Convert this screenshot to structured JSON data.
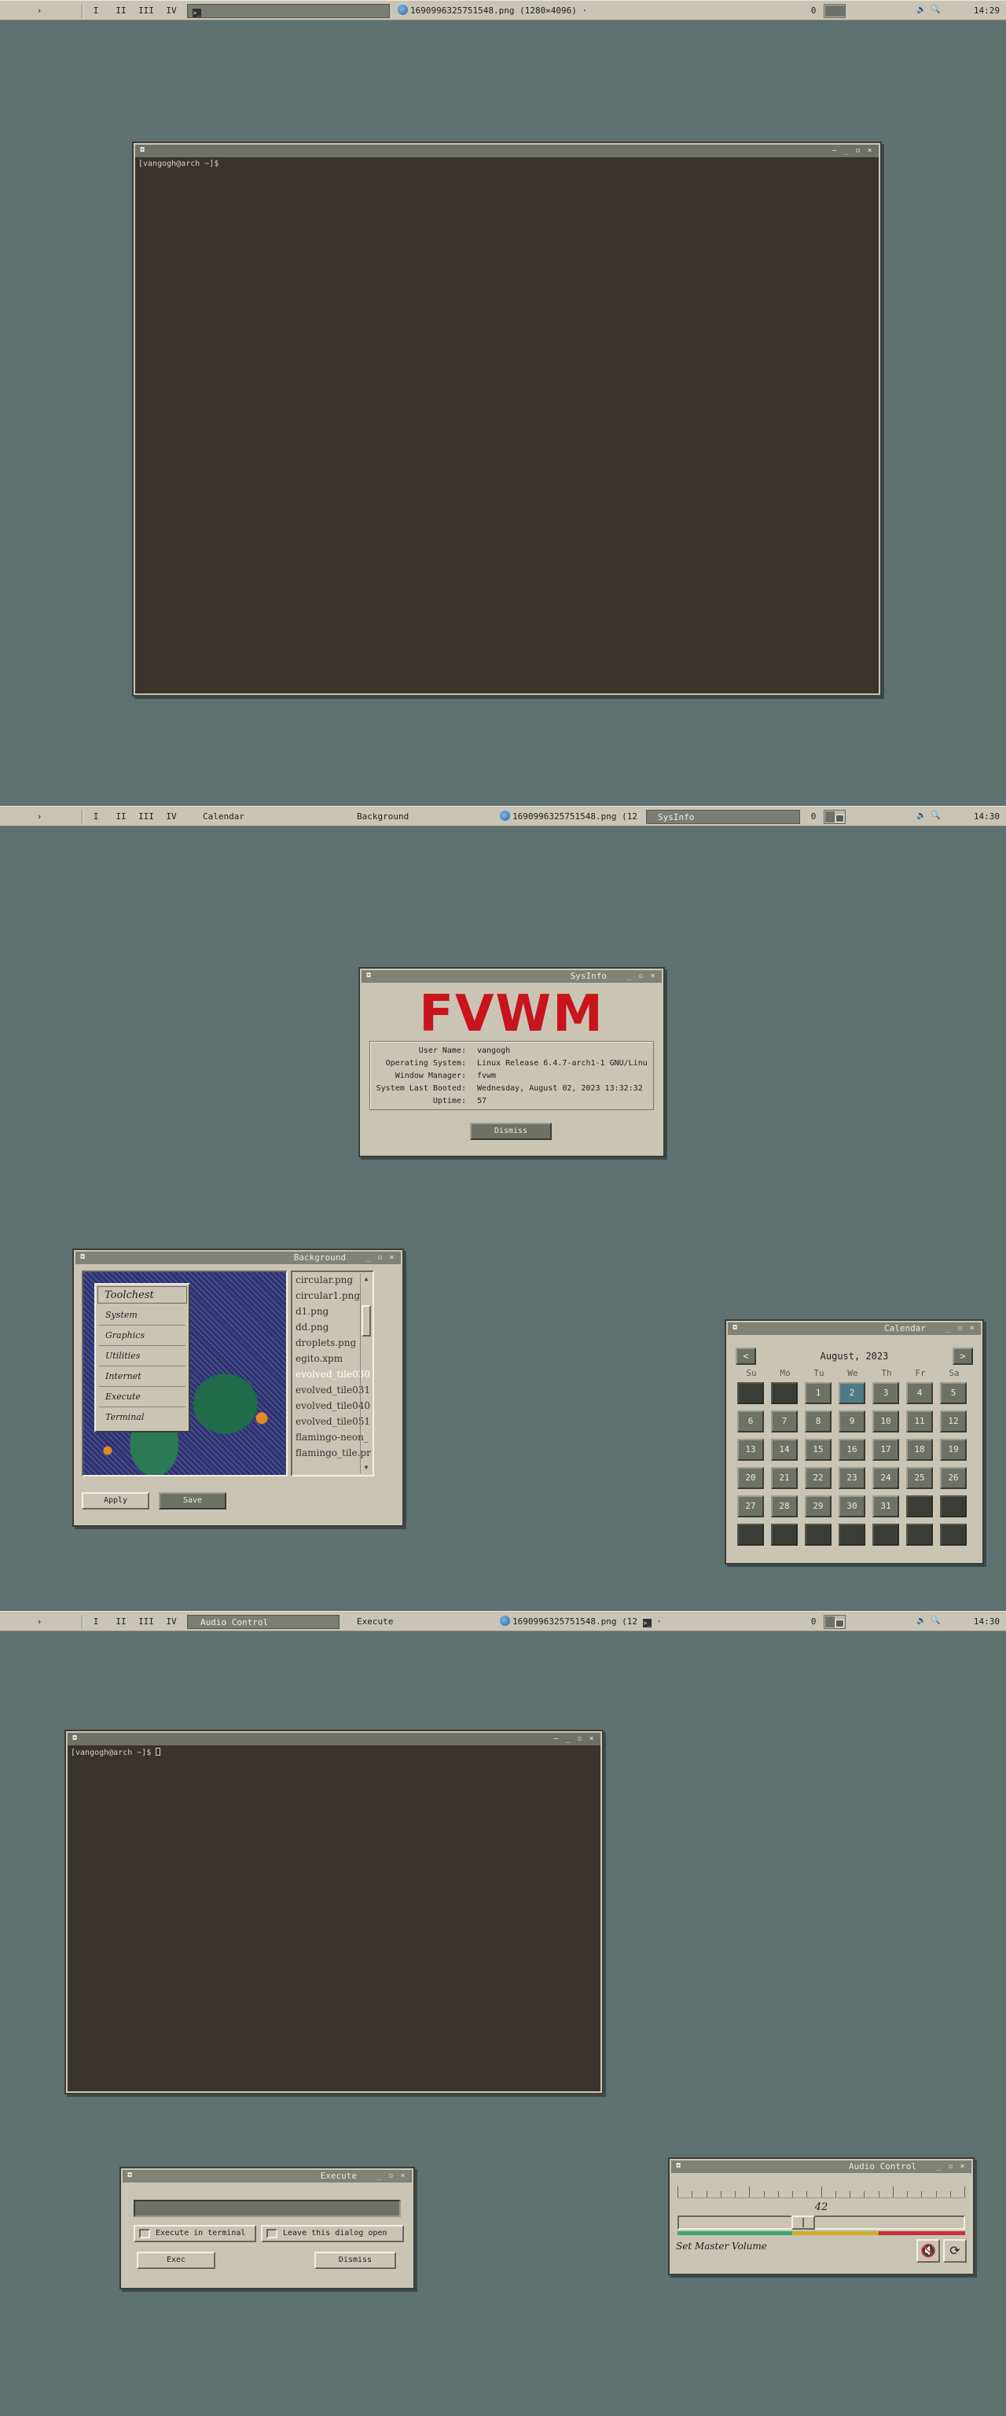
{
  "taskbar1": {
    "menu": "›",
    "desks": [
      "I",
      "II",
      "III",
      "IV"
    ],
    "windows": [
      {
        "label": "",
        "active": true
      },
      {
        "label": "1690996325751548.png (1280×4096) ·",
        "active": false
      }
    ],
    "num": "0",
    "clock": "14:29"
  },
  "taskbar2": {
    "menu": "›",
    "desks": [
      "I",
      "II",
      "III",
      "IV"
    ],
    "windows": [
      {
        "label": "Calendar"
      },
      {
        "label": "Background"
      },
      {
        "label": "1690996325751548.png (12"
      },
      {
        "label": "SysInfo"
      }
    ],
    "num": "0",
    "clock": "14:30"
  },
  "taskbar3": {
    "menu": "›",
    "desks": [
      "I",
      "II",
      "III",
      "IV"
    ],
    "windows": [
      {
        "label": "Audio Control"
      },
      {
        "label": "Execute"
      },
      {
        "label": "1690996325751548.png (12"
      }
    ],
    "num": "0",
    "clock": "14:30"
  },
  "terminal1": {
    "prompt": "[vangogh@arch ~]$"
  },
  "terminal2": {
    "prompt": "[vangogh@arch ~]$ "
  },
  "sysinfo": {
    "title": "SysInfo",
    "logo": "FVWM",
    "rows": [
      {
        "key": "User Name:",
        "value": "vangogh"
      },
      {
        "key": "Operating System:",
        "value": "Linux Release 6.4.7-arch1-1 GNU/Linu"
      },
      {
        "key": "Window Manager:",
        "value": "fvwm"
      },
      {
        "key": "System Last Booted:",
        "value": "Wednesday, August 02, 2023 13:32:32"
      },
      {
        "key": "Uptime:",
        "value": "57"
      }
    ],
    "dismiss": "Dismiss"
  },
  "background": {
    "title": "Background",
    "toolchest": {
      "title": "Toolchest",
      "items": [
        "System",
        "Graphics",
        "Utilities",
        "Internet",
        "Execute",
        "Terminal"
      ]
    },
    "files": [
      {
        "name": "circular.png",
        "selected": false
      },
      {
        "name": "circular1.png",
        "selected": false
      },
      {
        "name": "d1.png",
        "selected": false
      },
      {
        "name": "dd.png",
        "selected": false
      },
      {
        "name": "droplets.png",
        "selected": false
      },
      {
        "name": "egito.xpm",
        "selected": false
      },
      {
        "name": "evolved_tile030",
        "selected": true
      },
      {
        "name": "evolved_tile031",
        "selected": false
      },
      {
        "name": "evolved_tile040",
        "selected": false
      },
      {
        "name": "evolved_tile051",
        "selected": false
      },
      {
        "name": "flamingo-neon_",
        "selected": false
      },
      {
        "name": "flamingo_tile.pr",
        "selected": false
      }
    ],
    "apply": "Apply",
    "save": "Save"
  },
  "calendar": {
    "title": "Calendar",
    "month": "August, 2023",
    "prev": "<",
    "next": ">",
    "dow": [
      "Su",
      "Mo",
      "Tu",
      "We",
      "Th",
      "Fr",
      "Sa"
    ],
    "cells": [
      "",
      "",
      "1",
      "2",
      "3",
      "4",
      "5",
      "6",
      "7",
      "8",
      "9",
      "10",
      "11",
      "12",
      "13",
      "14",
      "15",
      "16",
      "17",
      "18",
      "19",
      "20",
      "21",
      "22",
      "23",
      "24",
      "25",
      "26",
      "27",
      "28",
      "29",
      "30",
      "31",
      "",
      "",
      "",
      "",
      "",
      "",
      "",
      "",
      ""
    ],
    "today": "2"
  },
  "execute": {
    "title": "Execute",
    "input_value": "",
    "chk_terminal": "Execute in terminal",
    "chk_open": "Leave this dialog open",
    "exec": "Exec",
    "dismiss": "Dismiss"
  },
  "audio": {
    "title": "Audio Control",
    "value": "42",
    "level": 0.42,
    "label": "Set Master Volume",
    "colors": [
      "#3aa86a",
      "#c8b02a",
      "#c8323a"
    ]
  }
}
